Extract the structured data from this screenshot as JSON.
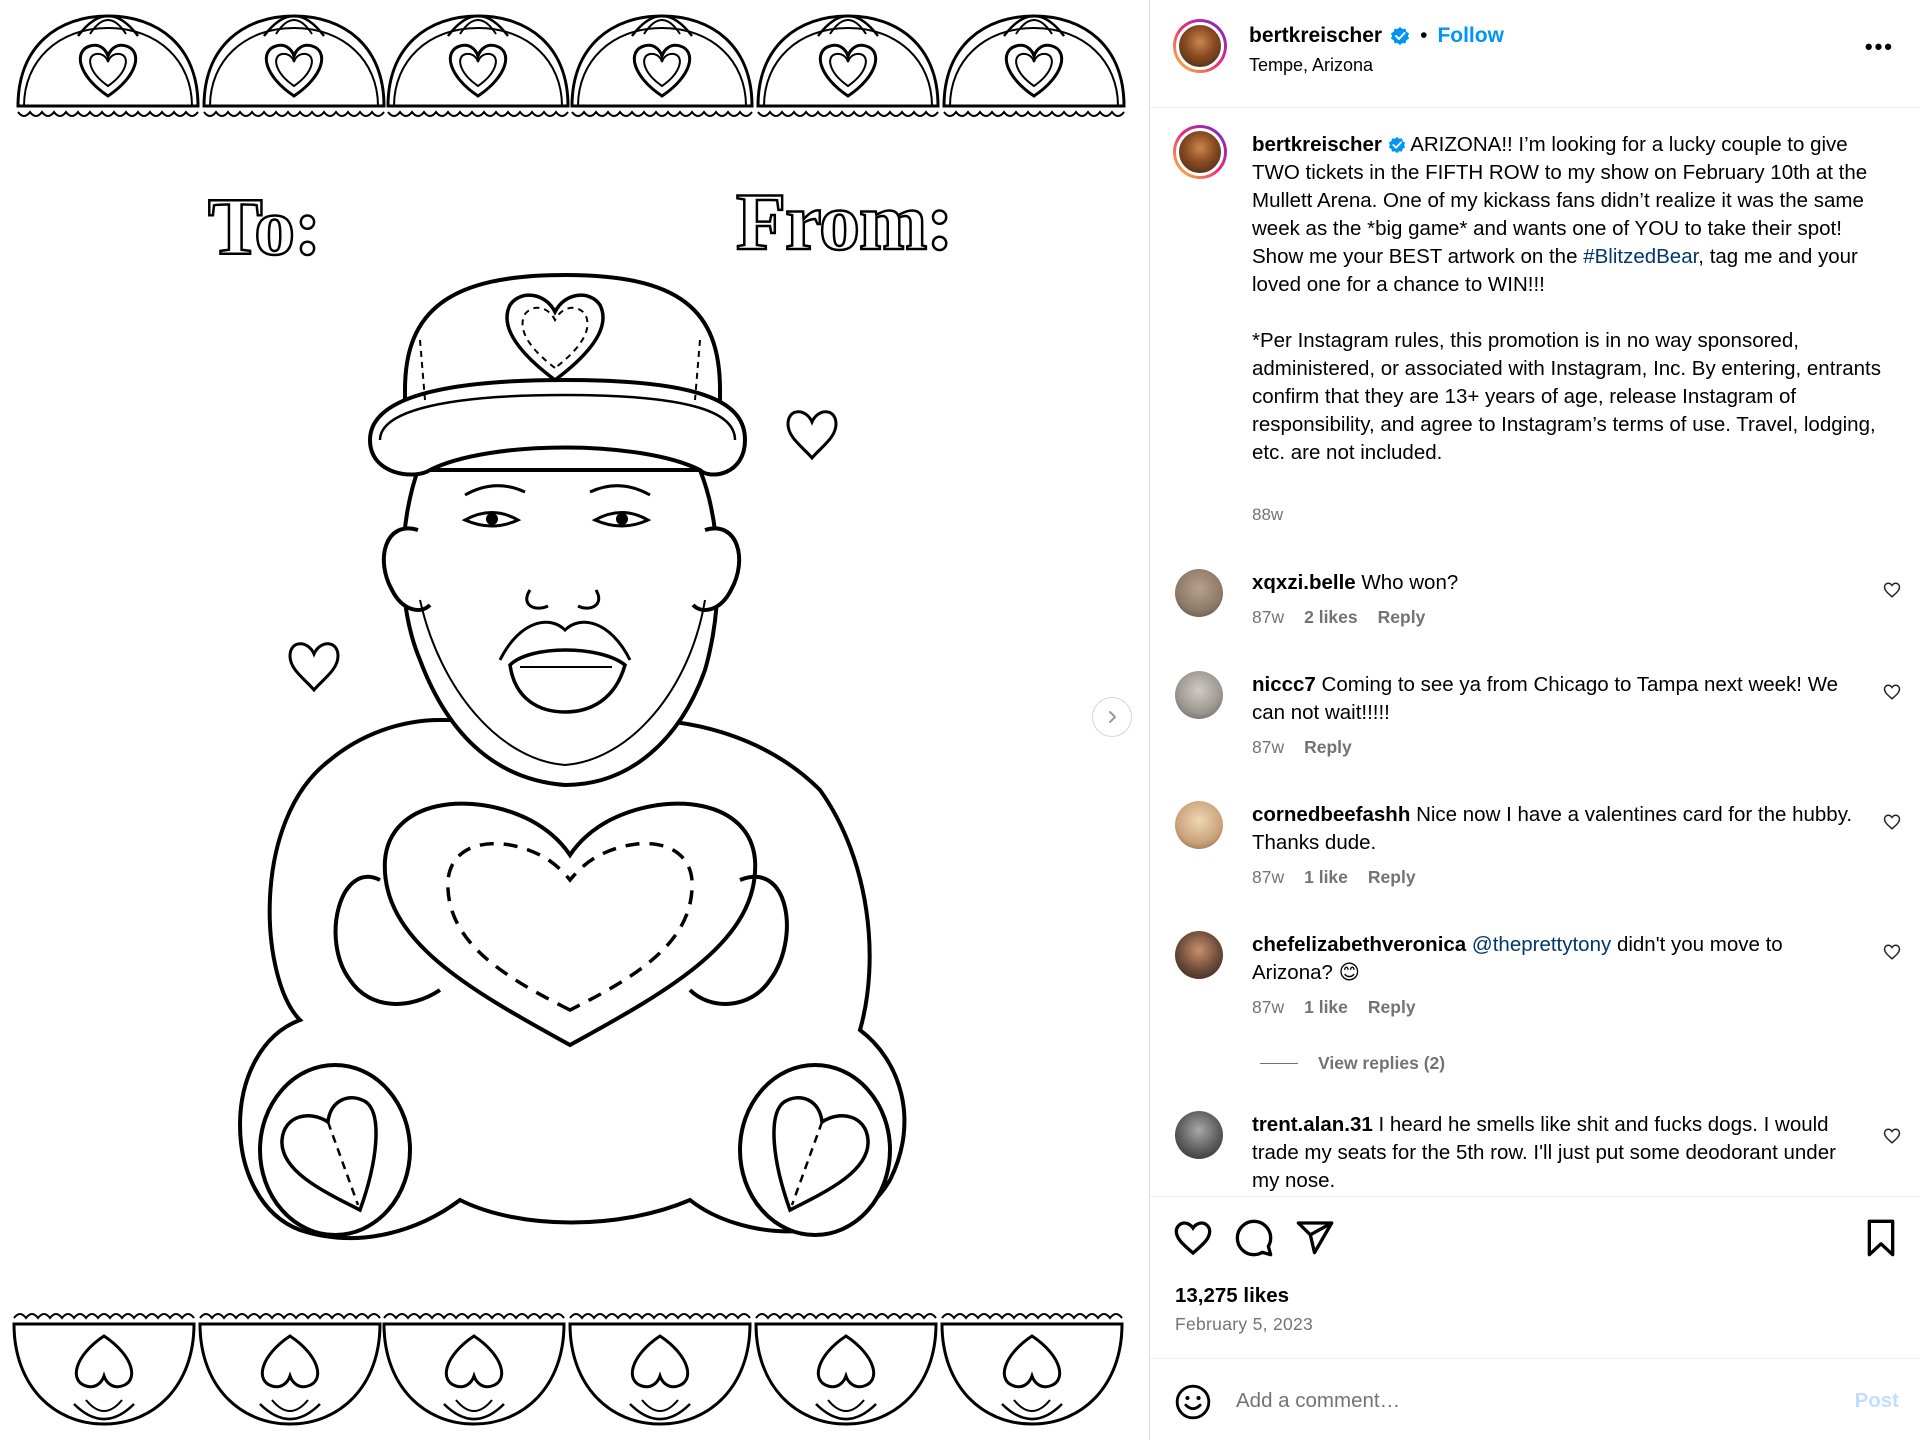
{
  "media": {
    "to_label": "To:",
    "from_label": "From:"
  },
  "header": {
    "username": "bertkreischer",
    "separator": "•",
    "follow_label": "Follow",
    "location": "Tempe, Arizona",
    "more_label": "•••"
  },
  "caption": {
    "username": "bertkreischer",
    "text_part1": "ARIZONA!! I’m looking for a lucky couple to give TWO tickets in the FIFTH ROW to my show on February 10th at the Mullett Arena. One of my kickass fans didn’t realize it was the same week as the *big game* and wants one of YOU to take their spot! Show me your BEST artwork on the ",
    "hashtag": "#BlitzedBear",
    "text_part2": ", tag me and your loved one for a chance to WIN!!!",
    "disclaimer": "*Per Instagram rules, this promotion is in no way sponsored, administered, or associated with Instagram, Inc. By entering, entrants confirm that they are 13+ years of age, release Instagram of responsibility, and agree to Instagram’s terms of use. Travel, lodging, etc. are not included.",
    "time": "88w"
  },
  "comments": [
    {
      "username": "xqxzi.belle",
      "text": "Who won?",
      "time": "87w",
      "likes": "2 likes",
      "reply": "Reply",
      "avatar_color": "#8d7a6a"
    },
    {
      "username": "niccc7",
      "text": "Coming to see ya from Chicago to Tampa next week! We can not wait!!!!!",
      "time": "87w",
      "likes": "",
      "reply": "Reply",
      "avatar_color": "#9a958f"
    },
    {
      "username": "cornedbeefashh",
      "text": "Nice now I have a valentines card for the hubby. Thanks dude.",
      "time": "87w",
      "likes": "1 like",
      "reply": "Reply",
      "avatar_color": "#c9a37a"
    },
    {
      "username": "chefelizabethveronica",
      "mention": "@theprettytony",
      "text": "didn't you move to Arizona? 😊",
      "time": "87w",
      "likes": "1 like",
      "reply": "Reply",
      "avatar_color": "#4a3328"
    },
    {
      "username": "trent.alan.31",
      "text": "I heard he smells like shit and fucks dogs. I would trade my seats for the 5th row. I'll just put some deodorant under my nose.",
      "avatar_color": "#5c5c5c"
    }
  ],
  "view_replies": "View replies (2)",
  "likes_count": "13,275 likes",
  "post_date": "February 5, 2023",
  "add_comment": {
    "placeholder": "Add a comment…",
    "post_label": "Post"
  },
  "colors": {
    "accent": "#0095f6",
    "link": "#00376b",
    "muted": "#737373",
    "post_disabled": "#c0dffd"
  }
}
